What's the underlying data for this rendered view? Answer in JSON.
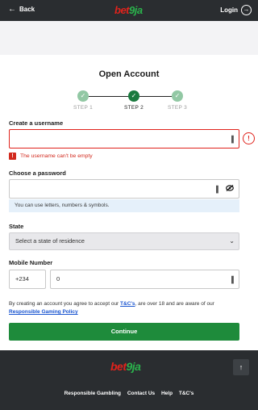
{
  "header": {
    "back_label": "Back",
    "logo_part1": "bet",
    "logo_part2": "9ja",
    "login_label": "Login"
  },
  "page": {
    "title": "Open Account"
  },
  "steps": [
    {
      "label": "STEP 1",
      "state": "done"
    },
    {
      "label": "STEP 2",
      "state": "active"
    },
    {
      "label": "STEP 3",
      "state": "done"
    }
  ],
  "form": {
    "username_label": "Create a username",
    "username_value": "",
    "username_error": "The username can't be empty",
    "password_label": "Choose a password",
    "password_value": "",
    "password_hint": "You can use letters, numbers & symbols.",
    "state_label": "State",
    "state_placeholder": "Select a state of residence",
    "mobile_label": "Mobile Number",
    "country_code": "+234",
    "mobile_value": "0"
  },
  "terms": {
    "text_before": "By creating an account you agree to accept our ",
    "tc_link": "T&C's",
    "text_middle": ", are over 18 and are aware of our ",
    "policy_link": "Responsible Gaming Policy"
  },
  "continue_label": "Continue",
  "footer": {
    "logo_part1": "bet",
    "logo_part2": "9ja",
    "links": [
      "Responsible Gambling",
      "Contact Us",
      "Help",
      "T&C's"
    ]
  },
  "colors": {
    "header_bg": "#2a2d30",
    "brand_red": "#e0231c",
    "brand_green": "#2bb24c",
    "button_green": "#1e8b3b",
    "error_red": "#d22a1e"
  }
}
